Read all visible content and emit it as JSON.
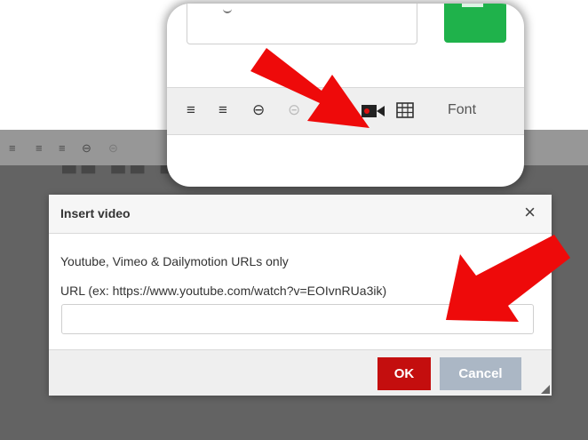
{
  "background_toolbar": {
    "items": [
      "≡",
      "≡",
      "≡",
      "⊖",
      "⊝"
    ]
  },
  "callout": {
    "toolbar_icons": [
      "≡",
      "≡",
      "⊖",
      "⊝"
    ],
    "font_label": "Font"
  },
  "dialog": {
    "title": "Insert video",
    "close_label": "×",
    "note": "Youtube, Vimeo & Dailymotion URLs only",
    "url_label": "URL (ex: https://www.youtube.com/watch?v=EOIvnRUa3ik)",
    "url_value": "",
    "url_placeholder": "",
    "ok_label": "OK",
    "cancel_label": "Cancel"
  },
  "colors": {
    "ok": "#c40e0e",
    "cancel": "#abb7c5",
    "arrow": "#ee0a0a",
    "camera_dot": "#e01010",
    "green_button": "#1fb24b"
  }
}
